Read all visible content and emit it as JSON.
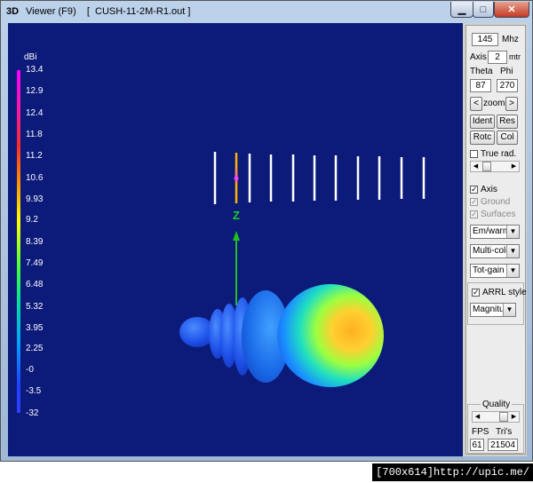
{
  "window": {
    "icon_label": "3D",
    "title": "Viewer (F9)    [  CUSH-11-2M-R1.out ]"
  },
  "scale": {
    "unit": "dBi",
    "ticks": [
      "13.4",
      "12.9",
      "12.4",
      "11.8",
      "11.2",
      "10.6",
      "9.93",
      "9.2",
      "8.39",
      "7.49",
      "6.48",
      "5.32",
      "3.95",
      "2.25",
      "-0",
      "-3.5",
      "-32"
    ]
  },
  "viewport": {
    "axis_label": "Z"
  },
  "panel": {
    "freq_value": "145",
    "freq_unit": "Mhz",
    "axis_label": "Axis",
    "axis_value": "2",
    "axis_unit": "mtr",
    "theta_label": "Theta",
    "phi_label": "Phi",
    "theta_value": "87",
    "phi_value": "270",
    "zoom_left": "<",
    "zoom_label": "zoom",
    "zoom_right": ">",
    "ident": "Ident",
    "res": "Res",
    "rotc": "Rotc",
    "col": "Col",
    "true_rad": "True rad.",
    "axis_check": "Axis",
    "ground": "Ground",
    "surfaces": "Surfaces",
    "combo1": "Em/warm",
    "combo2": "Multi-colo",
    "combo3": "Tot-gain",
    "arrl": "ARRL style",
    "combo4": "Magnitud",
    "quality": "Quality",
    "fps_label": "FPS",
    "tris_label": "Tri's",
    "fps_value": "61",
    "tris_value": "21504"
  },
  "watermark": "[700x614]http://upic.me/"
}
